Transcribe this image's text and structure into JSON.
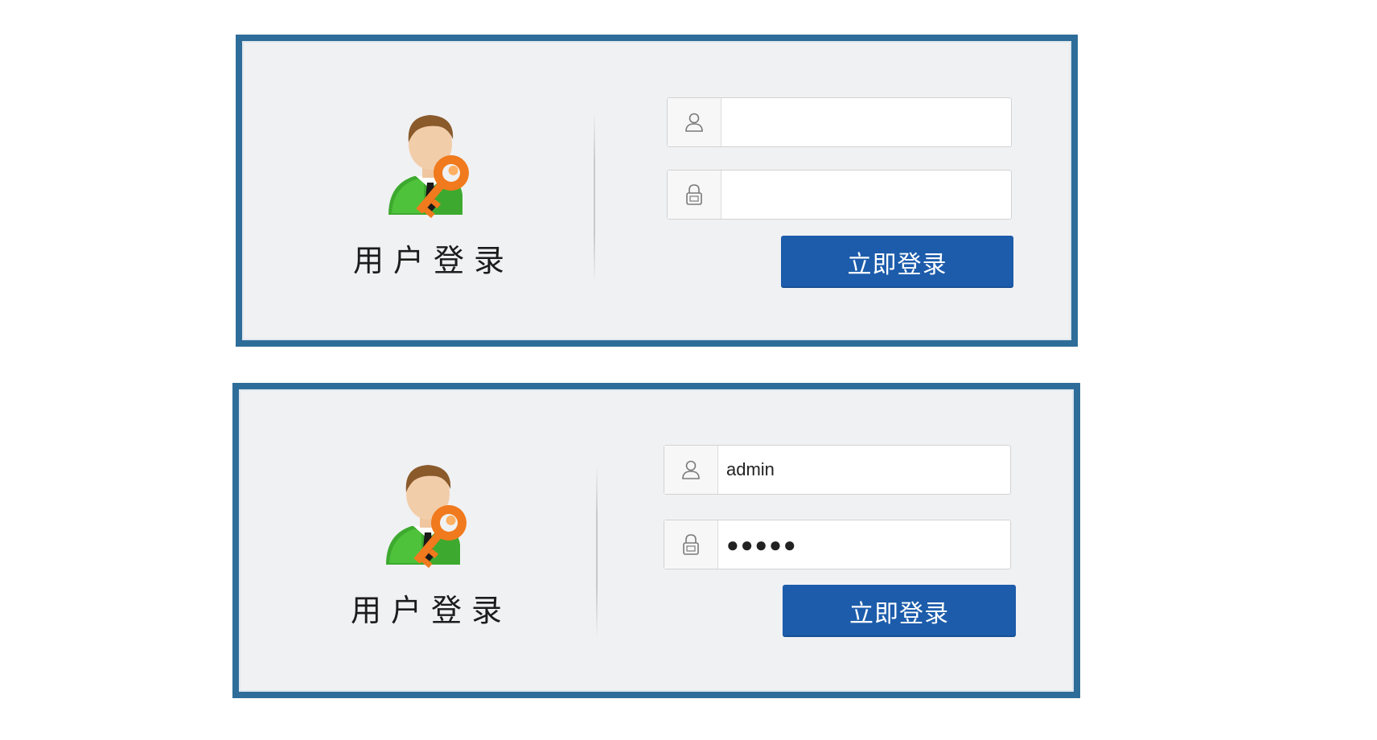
{
  "forms": [
    {
      "title": "用户登录",
      "username": {
        "icon": "user-icon",
        "value": "",
        "placeholder": ""
      },
      "password": {
        "icon": "lock-icon",
        "value": "",
        "placeholder": ""
      },
      "submit_label": "立即登录"
    },
    {
      "title": "用户登录",
      "username": {
        "icon": "user-icon",
        "value": "admin",
        "placeholder": ""
      },
      "password": {
        "icon": "lock-icon",
        "value": "●●●●●",
        "placeholder": ""
      },
      "submit_label": "立即登录"
    }
  ],
  "colors": {
    "frame": "#2e6d99",
    "panel_bg": "#f0f1f3",
    "button": "#1c5cab",
    "button_text": "#ffffff"
  }
}
